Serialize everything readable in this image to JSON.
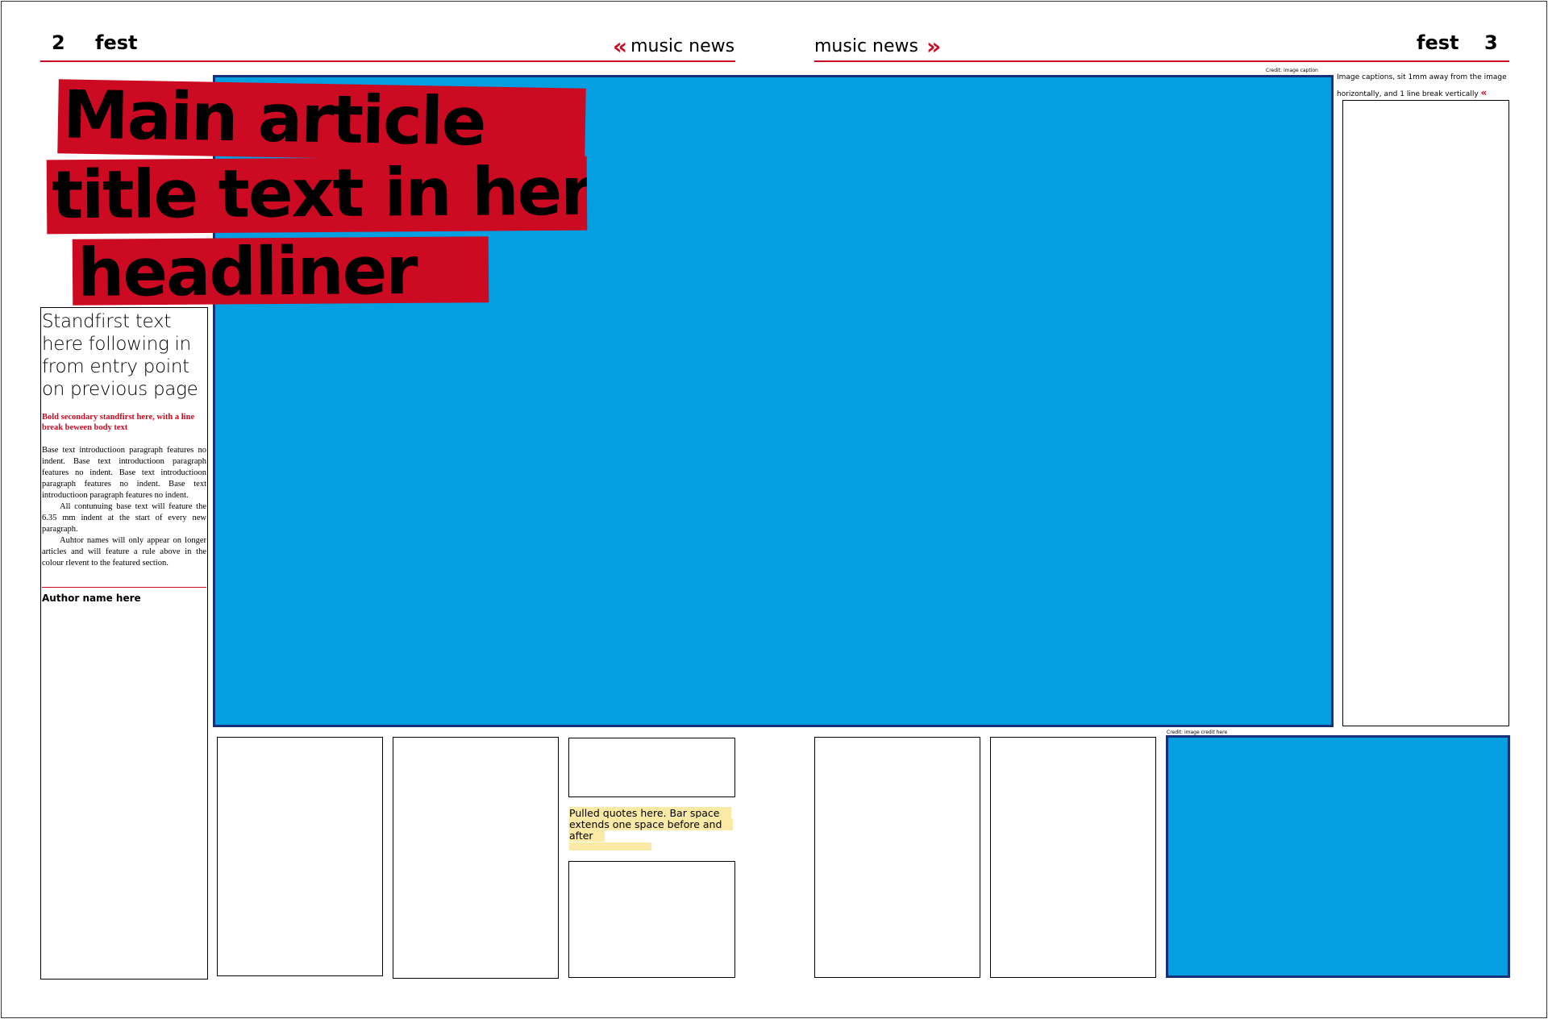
{
  "left_page": {
    "page_number": "2",
    "publication": "fest",
    "section": "music news",
    "section_marker": "«"
  },
  "right_page": {
    "page_number": "3",
    "publication": "fest",
    "section": "music news",
    "section_marker": "»"
  },
  "headline": {
    "line1": "Main article",
    "line2": "title text in here:",
    "line3": "headliner"
  },
  "standfirst": "Standfirst text here following in from entry point on previous page",
  "secondary_standfirst": "Bold secondary standfirst here, with a line break beween body text",
  "body": {
    "paragraph1": "Base text introductioon paragraph features no indent. Base text introductioon paragraph features no indent. Base text introductioon paragraph features no indent. Base text introductioon paragraph features no indent.",
    "paragraph2": "All contunuing base text will feature the 6.35 mm indent at the start of every new paragraph.",
    "paragraph3": "Auhtor names will only appear on longer articles and will feature a rule above in the colour rlevent to the featured section."
  },
  "author": "Author name here",
  "main_image_credit": "Credit: image caption",
  "image_caption": "Image captions, sit 1mm away from the image horizontally, and 1 line break vertically",
  "image_caption_marker": "«",
  "second_image_credit": "Credit: image credit here",
  "pull_quote": "Pulled quotes here. Bar space extends one space before and after",
  "colors": {
    "accent_red": "#cc0a22",
    "image_placeholder_blue": "#049fe0",
    "image_border_navy": "#17307a",
    "pull_quote_highlight": "#fbe9a6"
  }
}
